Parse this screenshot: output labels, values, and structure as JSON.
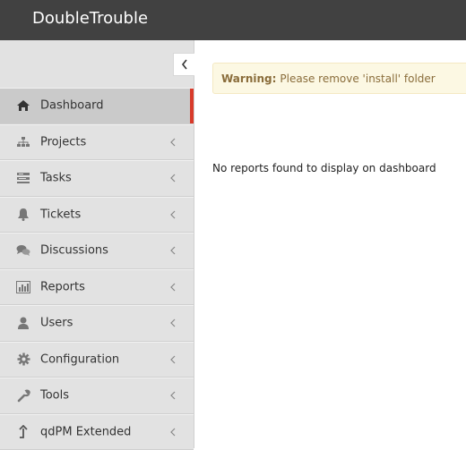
{
  "header": {
    "brand": "DoubleTrouble"
  },
  "sidebar": {
    "collapse_icon": "chevron-left-icon",
    "items": [
      {
        "label": "Dashboard",
        "icon": "home-icon",
        "active": true
      },
      {
        "label": "Projects",
        "icon": "sitemap-icon"
      },
      {
        "label": "Tasks",
        "icon": "tasks-icon"
      },
      {
        "label": "Tickets",
        "icon": "bell-icon"
      },
      {
        "label": "Discussions",
        "icon": "comments-icon"
      },
      {
        "label": "Reports",
        "icon": "bar-chart-icon"
      },
      {
        "label": "Users",
        "icon": "user-icon"
      },
      {
        "label": "Configuration",
        "icon": "gear-icon"
      },
      {
        "label": "Tools",
        "icon": "wrench-icon"
      },
      {
        "label": "qdPM Extended",
        "icon": "level-up-icon"
      }
    ]
  },
  "main": {
    "warning_title": "Warning:",
    "warning_text": "Please remove 'install' folder",
    "empty_message": "No reports found to display on dashboard"
  },
  "colors": {
    "topbar": "#414141",
    "sidebar": "#e2e2e2",
    "active_indicator": "#d83a2a",
    "warning_bg": "#fcf8e3",
    "warning_text": "#8a6d3b"
  }
}
